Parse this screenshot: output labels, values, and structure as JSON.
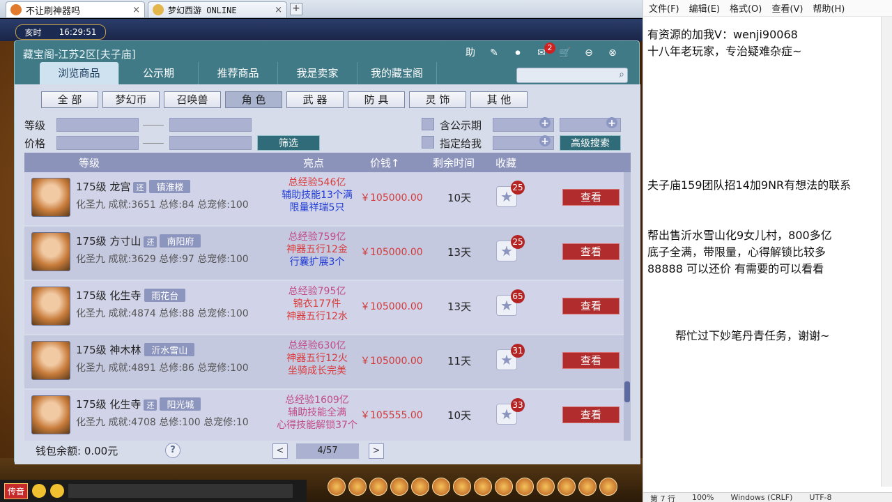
{
  "browser": {
    "tabs": [
      {
        "title": "不让刷神器吗",
        "close": "×"
      },
      {
        "title": "梦幻西游 ONLINE",
        "close": "×"
      }
    ],
    "new_tab": "+"
  },
  "game": {
    "clock_period": "亥时",
    "clock_time": "16:29:51",
    "chat_voice": "传音"
  },
  "window": {
    "title": "藏宝阁-江苏2区[夫子庙]",
    "icons": {
      "help": "助",
      "msg_badge": "2"
    },
    "nav": [
      "浏览商品",
      "公示期",
      "推荐商品",
      "我是卖家",
      "我的藏宝阁"
    ],
    "search_placeholder": "",
    "categories": [
      "全 部",
      "梦幻币",
      "召唤兽",
      "角 色",
      "武 器",
      "防 具",
      "灵 饰",
      "其 他"
    ],
    "filters": {
      "level": "等级",
      "price": "价格",
      "filter_button": "筛选",
      "include_public": "含公示期",
      "assign_me": "指定给我",
      "advanced_button": "高级搜索"
    },
    "columns": {
      "level": "等级",
      "highlight": "亮点",
      "price": "价钱↑",
      "remain": "剩余时间",
      "fav": "收藏"
    },
    "rows": [
      {
        "level": "175级",
        "school": "龙宫",
        "tag": "还",
        "server": "镇淮楼",
        "detail": "化圣九 成就:3651 总修:84 总宠修:100",
        "h1": "总经验546亿",
        "h2": "辅助技能13个满",
        "h3": "限量祥瑞5只",
        "price": "￥105000.00",
        "remain": "10天",
        "fav": "25",
        "view": "查看"
      },
      {
        "level": "175级",
        "school": "方寸山",
        "tag": "还",
        "server": "南阳府",
        "detail": "化圣九 成就:3629 总修:97 总宠修:100",
        "h1": "总经验759亿",
        "h2": "神器五行12金",
        "h3": "行囊扩展3个",
        "price": "￥105000.00",
        "remain": "13天",
        "fav": "25",
        "view": "查看"
      },
      {
        "level": "175级",
        "school": "化生寺",
        "tag": "",
        "server": "雨花台",
        "detail": "化圣九 成就:4874 总修:88 总宠修:100",
        "h1": "总经验795亿",
        "h2": "锦衣177件",
        "h3": "神器五行12水",
        "price": "￥105000.00",
        "remain": "13天",
        "fav": "65",
        "view": "查看"
      },
      {
        "level": "175级",
        "school": "神木林",
        "tag": "",
        "server": "沂水雪山",
        "detail": "化圣九 成就:4891 总修:86 总宠修:100",
        "h1": "总经验630亿",
        "h2": "神器五行12火",
        "h3": "坐骑成长完美",
        "price": "￥105000.00",
        "remain": "11天",
        "fav": "31",
        "view": "查看"
      },
      {
        "level": "175级",
        "school": "化生寺",
        "tag": "还",
        "server": "阳光城",
        "detail": "化圣九 成就:4708 总修:100 总宠修:10",
        "h1": "总经验1609亿",
        "h2": "辅助技能全满",
        "h3": "心得技能解锁37个",
        "price": "￥105555.00",
        "remain": "10天",
        "fav": "33",
        "view": "查看"
      }
    ],
    "wallet": "钱包余额: 0.00元",
    "help": "?",
    "page": "4/57",
    "prev": "<",
    "next": ">"
  },
  "editor": {
    "menu": [
      "文件(F)",
      "编辑(E)",
      "格式(O)",
      "查看(V)",
      "帮助(H)"
    ],
    "lines": [
      "有资源的加我V：wenji90068",
      "十八年老玩家，专治疑难杂症~",
      "夫子庙159团队招14加9NR有想法的联系",
      "帮出售沂水雪山化9女儿村，800多亿",
      "底子全满，带限量，心得解锁比较多",
      "88888 可以还价 有需要的可以看看",
      "帮忙过下妙笔丹青任务，谢谢~"
    ],
    "status": [
      "第 7 行",
      "100%",
      "Windows (CRLF)",
      "UTF-8"
    ]
  },
  "colors": {
    "accent": "#3f7a86",
    "view_button": "#b12c2c",
    "panel": "#d7dcea"
  }
}
